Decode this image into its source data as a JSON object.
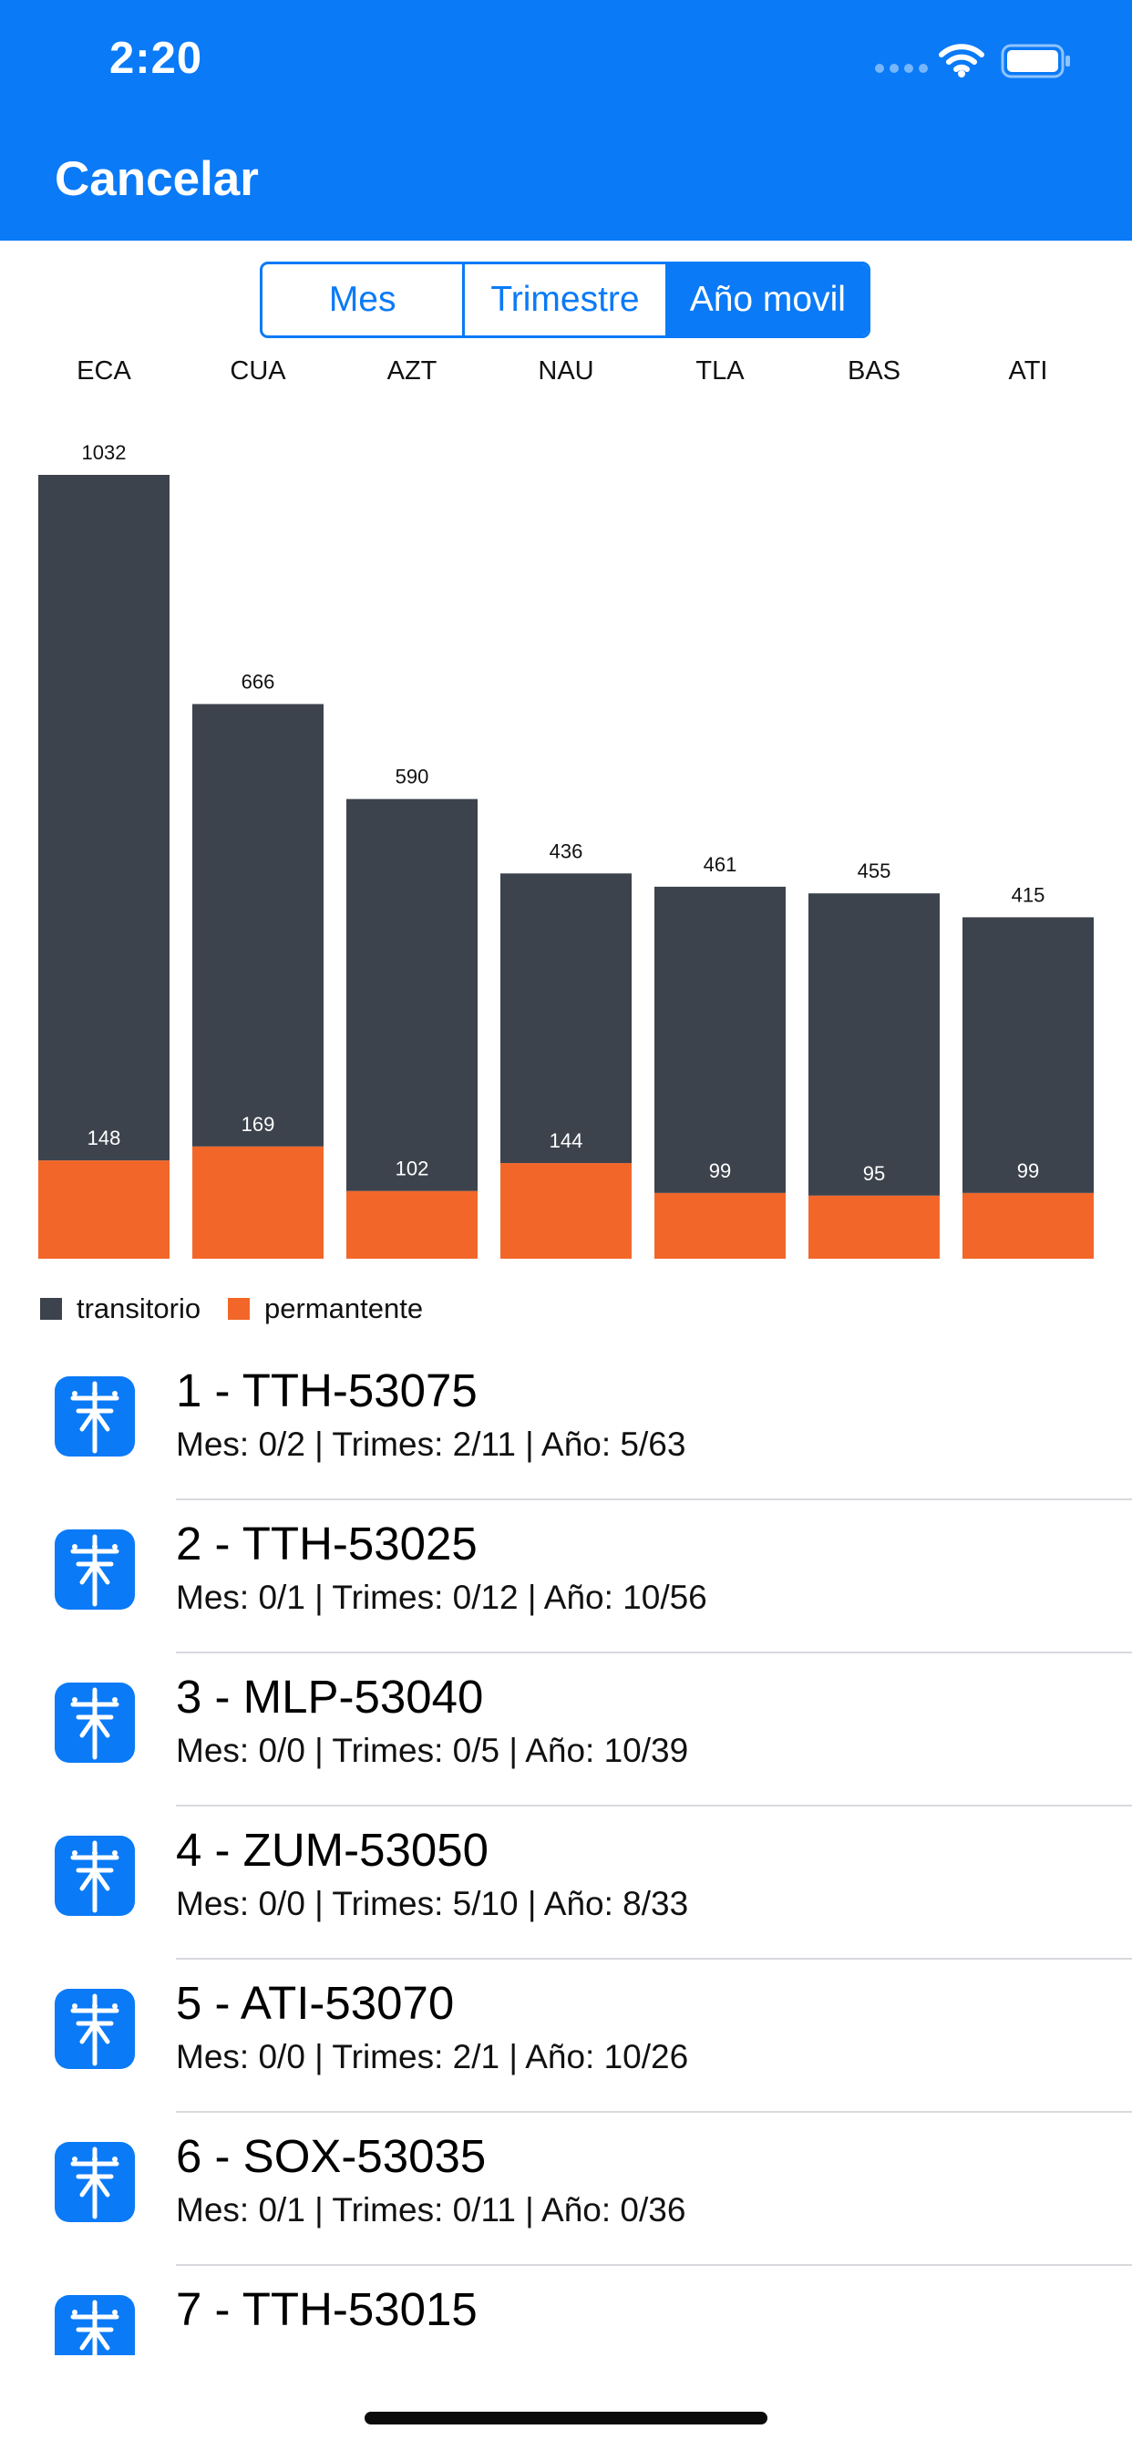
{
  "status_bar": {
    "time": "2:20"
  },
  "nav": {
    "cancel_label": "Cancelar"
  },
  "segmented_control": {
    "segments": [
      "Mes",
      "Trimestre",
      "Año movil"
    ],
    "selected_index": 2
  },
  "colors": {
    "accent": "#0a7af7",
    "transitorio": "#3d434c",
    "permanente": "#f26729",
    "axis_text": "#111111"
  },
  "chart_data": {
    "type": "bar",
    "categories": [
      "ECA",
      "CUA",
      "AZT",
      "NAU",
      "TLA",
      "BAS",
      "ATI"
    ],
    "series": [
      {
        "name": "transitorio",
        "values": [
          1032,
          666,
          590,
          436,
          461,
          455,
          415
        ]
      },
      {
        "name": "permantente",
        "values": [
          148,
          169,
          102,
          144,
          99,
          95,
          99
        ]
      }
    ]
  },
  "legend": {
    "items": [
      "transitorio",
      "permantente"
    ]
  },
  "list": {
    "items": [
      {
        "title": "1 - TTH-53075",
        "subtitle": "Mes: 0/2 | Trimes: 2/11 | Año: 5/63"
      },
      {
        "title": "2 - TTH-53025",
        "subtitle": "Mes: 0/1 | Trimes: 0/12 | Año: 10/56"
      },
      {
        "title": "3 - MLP-53040",
        "subtitle": "Mes: 0/0 | Trimes: 0/5 | Año: 10/39"
      },
      {
        "title": "4 - ZUM-53050",
        "subtitle": "Mes: 0/0 | Trimes: 5/10 | Año: 8/33"
      },
      {
        "title": "5 - ATI-53070",
        "subtitle": "Mes: 0/0 | Trimes: 2/1 | Año: 10/26"
      },
      {
        "title": "6 - SOX-53035",
        "subtitle": "Mes: 0/1 | Trimes: 0/11 | Año: 0/36"
      },
      {
        "title": "7 - TTH-53015",
        "subtitle": ""
      }
    ]
  }
}
